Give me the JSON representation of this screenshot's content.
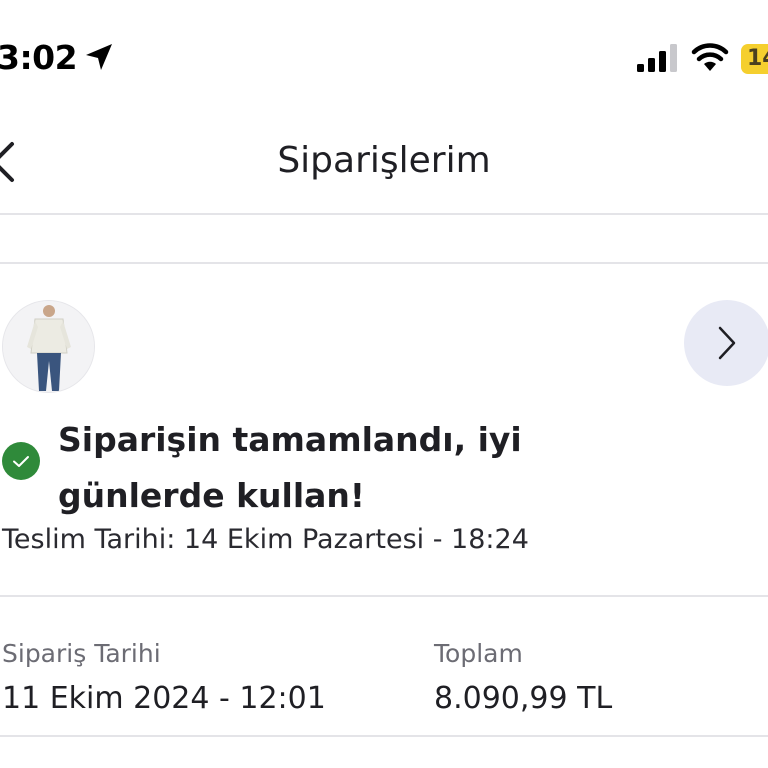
{
  "status_bar": {
    "time": "3:02",
    "battery_level": "14",
    "icons": [
      "location-arrow-icon",
      "cellular-signal-icon",
      "wifi-icon",
      "battery-icon"
    ]
  },
  "nav": {
    "back_icon": "chevron-left-icon",
    "title": "Siparişlerim"
  },
  "order": {
    "product_image": "jacket-jeans-outfit",
    "detail_icon": "chevron-right-icon",
    "status_icon": "check-circle-icon",
    "status_message": "Siparişin tamamlandı, iyi günlerde kullan!",
    "delivery_text": "Teslim Tarihi: 14 Ekim Pazartesi - 18:24"
  },
  "summary": {
    "order_date_label": "Sipariş Tarihi",
    "order_date_value": "11 Ekim 2024 - 12:01",
    "total_label": "Toplam",
    "total_value": "8.090,99 TL"
  },
  "colors": {
    "success_green": "#2f8a3a",
    "detail_button_bg": "#e8eaf5",
    "divider": "#e4e4e8",
    "battery_yellow": "#f5cf2e"
  }
}
